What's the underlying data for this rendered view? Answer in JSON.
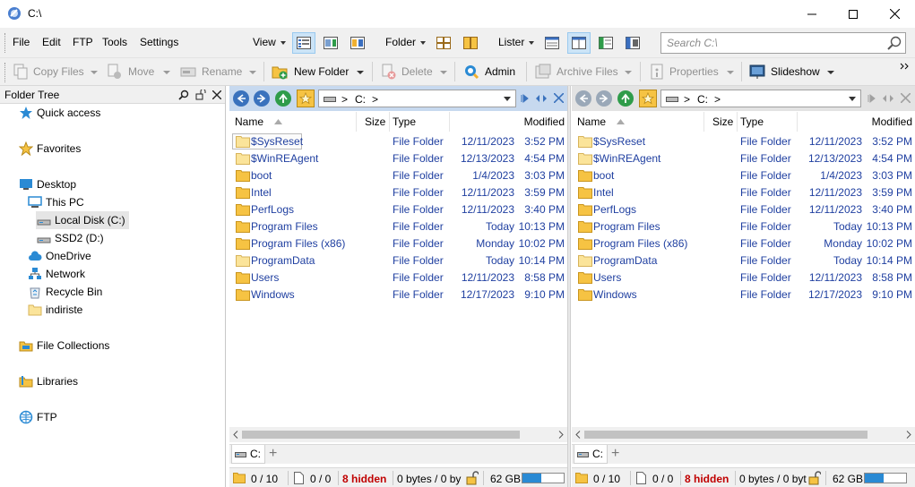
{
  "window": {
    "title": "C:\\"
  },
  "menu": [
    "File",
    "Edit",
    "FTP",
    "Tools",
    "Settings"
  ],
  "view_menus": {
    "view": "View",
    "folder": "Folder",
    "lister": "Lister"
  },
  "search": {
    "placeholder": "Search C:\\"
  },
  "toolbar": {
    "copy_files": "Copy Files",
    "move": "Move",
    "rename": "Rename",
    "new_folder": "New Folder",
    "delete": "Delete",
    "admin": "Admin",
    "archive_files": "Archive Files",
    "properties": "Properties",
    "slideshow": "Slideshow"
  },
  "folder_tree": {
    "title": "Folder Tree",
    "items": [
      {
        "label": "Quick access",
        "icon": "star-blue-icon"
      },
      {
        "label": "Favorites",
        "icon": "star-icon"
      },
      {
        "label": "Desktop",
        "icon": "desktop-icon"
      },
      {
        "label": "This PC",
        "icon": "computer-icon"
      },
      {
        "label": "Local Disk (C:)",
        "icon": "drive-icon",
        "selected": true
      },
      {
        "label": "SSD2 (D:)",
        "icon": "drive-icon"
      },
      {
        "label": "OneDrive",
        "icon": "cloud-icon"
      },
      {
        "label": "Network",
        "icon": "network-icon"
      },
      {
        "label": "Recycle Bin",
        "icon": "recycle-bin-icon"
      },
      {
        "label": "indiriste",
        "icon": "folder-icon"
      },
      {
        "label": "File Collections",
        "icon": "collections-icon"
      },
      {
        "label": "Libraries",
        "icon": "libraries-icon"
      },
      {
        "label": "FTP",
        "icon": "ftp-icon"
      }
    ]
  },
  "columns": {
    "name": "Name",
    "size": "Size",
    "type": "Type",
    "modified": "Modified"
  },
  "path": {
    "drive": "C:",
    "sep": ">"
  },
  "files": [
    {
      "name": "$SysReset",
      "type": "File Folder",
      "date": "12/11/2023",
      "time": "3:52 PM",
      "pale": true
    },
    {
      "name": "$WinREAgent",
      "type": "File Folder",
      "date": "12/13/2023",
      "time": "4:54 PM",
      "pale": true
    },
    {
      "name": "boot",
      "type": "File Folder",
      "date": "1/4/2023",
      "time": "3:03 PM",
      "pale": false
    },
    {
      "name": "Intel",
      "type": "File Folder",
      "date": "12/11/2023",
      "time": "3:59 PM",
      "pale": false
    },
    {
      "name": "PerfLogs",
      "type": "File Folder",
      "date": "12/11/2023",
      "time": "3:40 PM",
      "pale": false
    },
    {
      "name": "Program Files",
      "type": "File Folder",
      "date": "Today",
      "time": "10:13 PM",
      "pale": false
    },
    {
      "name": "Program Files (x86)",
      "type": "File Folder",
      "date": "Monday",
      "time": "10:02 PM",
      "pale": false
    },
    {
      "name": "ProgramData",
      "type": "File Folder",
      "date": "Today",
      "time": "10:14 PM",
      "pale": true
    },
    {
      "name": "Users",
      "type": "File Folder",
      "date": "12/11/2023",
      "time": "8:58 PM",
      "pale": false
    },
    {
      "name": "Windows",
      "type": "File Folder",
      "date": "12/17/2023",
      "time": "9:10 PM",
      "pale": false
    }
  ],
  "tab_label": "C:",
  "status": {
    "folders": "0 / 10",
    "files": "0 / 0",
    "hidden": "8 hidden",
    "bytes_left": "0 bytes / 0 by",
    "bytes_right": "0 bytes / 0 byt",
    "free": "62 GB",
    "usage_fraction": 0.45
  },
  "colors": {
    "accent": "#2a8ad4",
    "folder": "#f6c343",
    "link": "#1f3fa0",
    "hidden": "#c00000",
    "active_nav": "#c7d9ef"
  }
}
